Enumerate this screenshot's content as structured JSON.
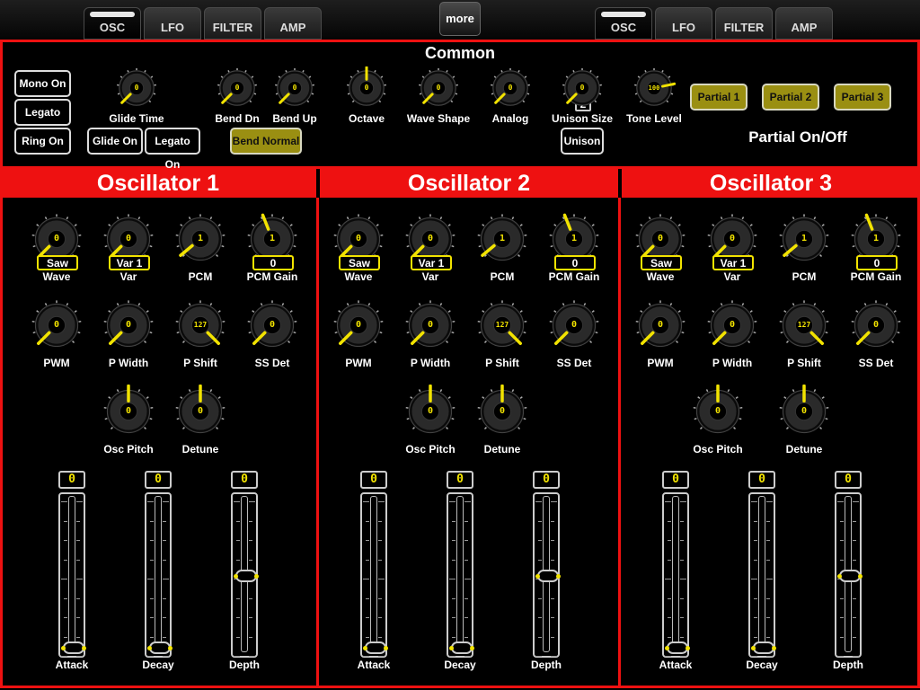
{
  "tabs_left": [
    {
      "label": "OSC",
      "active": true
    },
    {
      "label": "LFO",
      "active": false
    },
    {
      "label": "FILTER",
      "active": false
    },
    {
      "label": "AMP",
      "active": false
    }
  ],
  "tabs_right": [
    {
      "label": "OSC",
      "active": true
    },
    {
      "label": "LFO",
      "active": false
    },
    {
      "label": "FILTER",
      "active": false
    },
    {
      "label": "AMP",
      "active": false
    }
  ],
  "more_label": "more",
  "common": {
    "title": "Common",
    "mono_on": "Mono On",
    "legato_on": "Legato On",
    "ring_on": "Ring On",
    "glide_on": "Glide On",
    "legato_on_2": "Legato On",
    "bend_normal": "Bend Normal",
    "unison": "Unison",
    "unison_value": "2",
    "partial_1": "Partial 1",
    "partial_2": "Partial 2",
    "partial_3": "Partial 3",
    "partial_caption": "Partial On/Off",
    "knobs": [
      {
        "label": "Glide Time",
        "value": "0",
        "pos": 0.0
      },
      {
        "label": "Bend Dn",
        "value": "0",
        "pos": 0.0
      },
      {
        "label": "Bend Up",
        "value": "0",
        "pos": 0.0
      },
      {
        "label": "Octave",
        "value": "0",
        "pos": 0.5
      },
      {
        "label": "Wave Shape",
        "value": "0",
        "pos": 0.0
      },
      {
        "label": "Analog",
        "value": "0",
        "pos": 0.0
      },
      {
        "label": "Unison Size",
        "value": "0",
        "pos": 0.0
      },
      {
        "label": "Tone Level",
        "value": "100",
        "pos": 0.79
      }
    ]
  },
  "oscillators": [
    {
      "title": "Oscillator 1",
      "knobs": [
        {
          "label": "Wave",
          "value": "0",
          "pos": 0.0,
          "box": "Saw"
        },
        {
          "label": "Var",
          "value": "0",
          "pos": 0.0,
          "box": "Var 1"
        },
        {
          "label": "PCM",
          "value": "1",
          "pos": 0.02
        },
        {
          "label": "PCM Gain",
          "value": "1",
          "pos": 0.42,
          "box": "0"
        },
        {
          "label": "PWM",
          "value": "0",
          "pos": 0.0
        },
        {
          "label": "P Width",
          "value": "0",
          "pos": 0.0
        },
        {
          "label": "P Shift",
          "value": "127",
          "pos": 1.0
        },
        {
          "label": "SS Det",
          "value": "0",
          "pos": 0.0
        },
        {
          "label": "Osc Pitch",
          "value": "0",
          "pos": 0.5
        },
        {
          "label": "Detune",
          "value": "0",
          "pos": 0.5
        }
      ],
      "sliders": [
        {
          "label": "Attack",
          "value": "0",
          "pos": 0.0
        },
        {
          "label": "Decay",
          "value": "0",
          "pos": 0.0
        },
        {
          "label": "Depth",
          "value": "0",
          "pos": 0.5
        }
      ]
    },
    {
      "title": "Oscillator 2",
      "knobs": [
        {
          "label": "Wave",
          "value": "0",
          "pos": 0.0,
          "box": "Saw"
        },
        {
          "label": "Var",
          "value": "0",
          "pos": 0.0,
          "box": "Var 1"
        },
        {
          "label": "PCM",
          "value": "1",
          "pos": 0.02
        },
        {
          "label": "PCM Gain",
          "value": "1",
          "pos": 0.42,
          "box": "0"
        },
        {
          "label": "PWM",
          "value": "0",
          "pos": 0.0
        },
        {
          "label": "P Width",
          "value": "0",
          "pos": 0.0
        },
        {
          "label": "P Shift",
          "value": "127",
          "pos": 1.0
        },
        {
          "label": "SS Det",
          "value": "0",
          "pos": 0.0
        },
        {
          "label": "Osc Pitch",
          "value": "0",
          "pos": 0.5
        },
        {
          "label": "Detune",
          "value": "0",
          "pos": 0.5
        }
      ],
      "sliders": [
        {
          "label": "Attack",
          "value": "0",
          "pos": 0.0
        },
        {
          "label": "Decay",
          "value": "0",
          "pos": 0.0
        },
        {
          "label": "Depth",
          "value": "0",
          "pos": 0.5
        }
      ]
    },
    {
      "title": "Oscillator 3",
      "knobs": [
        {
          "label": "Wave",
          "value": "0",
          "pos": 0.0,
          "box": "Saw"
        },
        {
          "label": "Var",
          "value": "0",
          "pos": 0.0,
          "box": "Var 1"
        },
        {
          "label": "PCM",
          "value": "1",
          "pos": 0.02
        },
        {
          "label": "PCM Gain",
          "value": "1",
          "pos": 0.42,
          "box": "0"
        },
        {
          "label": "PWM",
          "value": "0",
          "pos": 0.0
        },
        {
          "label": "P Width",
          "value": "0",
          "pos": 0.0
        },
        {
          "label": "P Shift",
          "value": "127",
          "pos": 1.0
        },
        {
          "label": "SS Det",
          "value": "0",
          "pos": 0.0
        },
        {
          "label": "Osc Pitch",
          "value": "0",
          "pos": 0.5
        },
        {
          "label": "Detune",
          "value": "0",
          "pos": 0.5
        }
      ],
      "sliders": [
        {
          "label": "Attack",
          "value": "0",
          "pos": 0.0
        },
        {
          "label": "Decay",
          "value": "0",
          "pos": 0.0
        },
        {
          "label": "Depth",
          "value": "0",
          "pos": 0.5
        }
      ]
    }
  ],
  "colors": {
    "accent": "#f2e300",
    "border_red": "#e11111",
    "olive_button": "#9a8f12"
  }
}
